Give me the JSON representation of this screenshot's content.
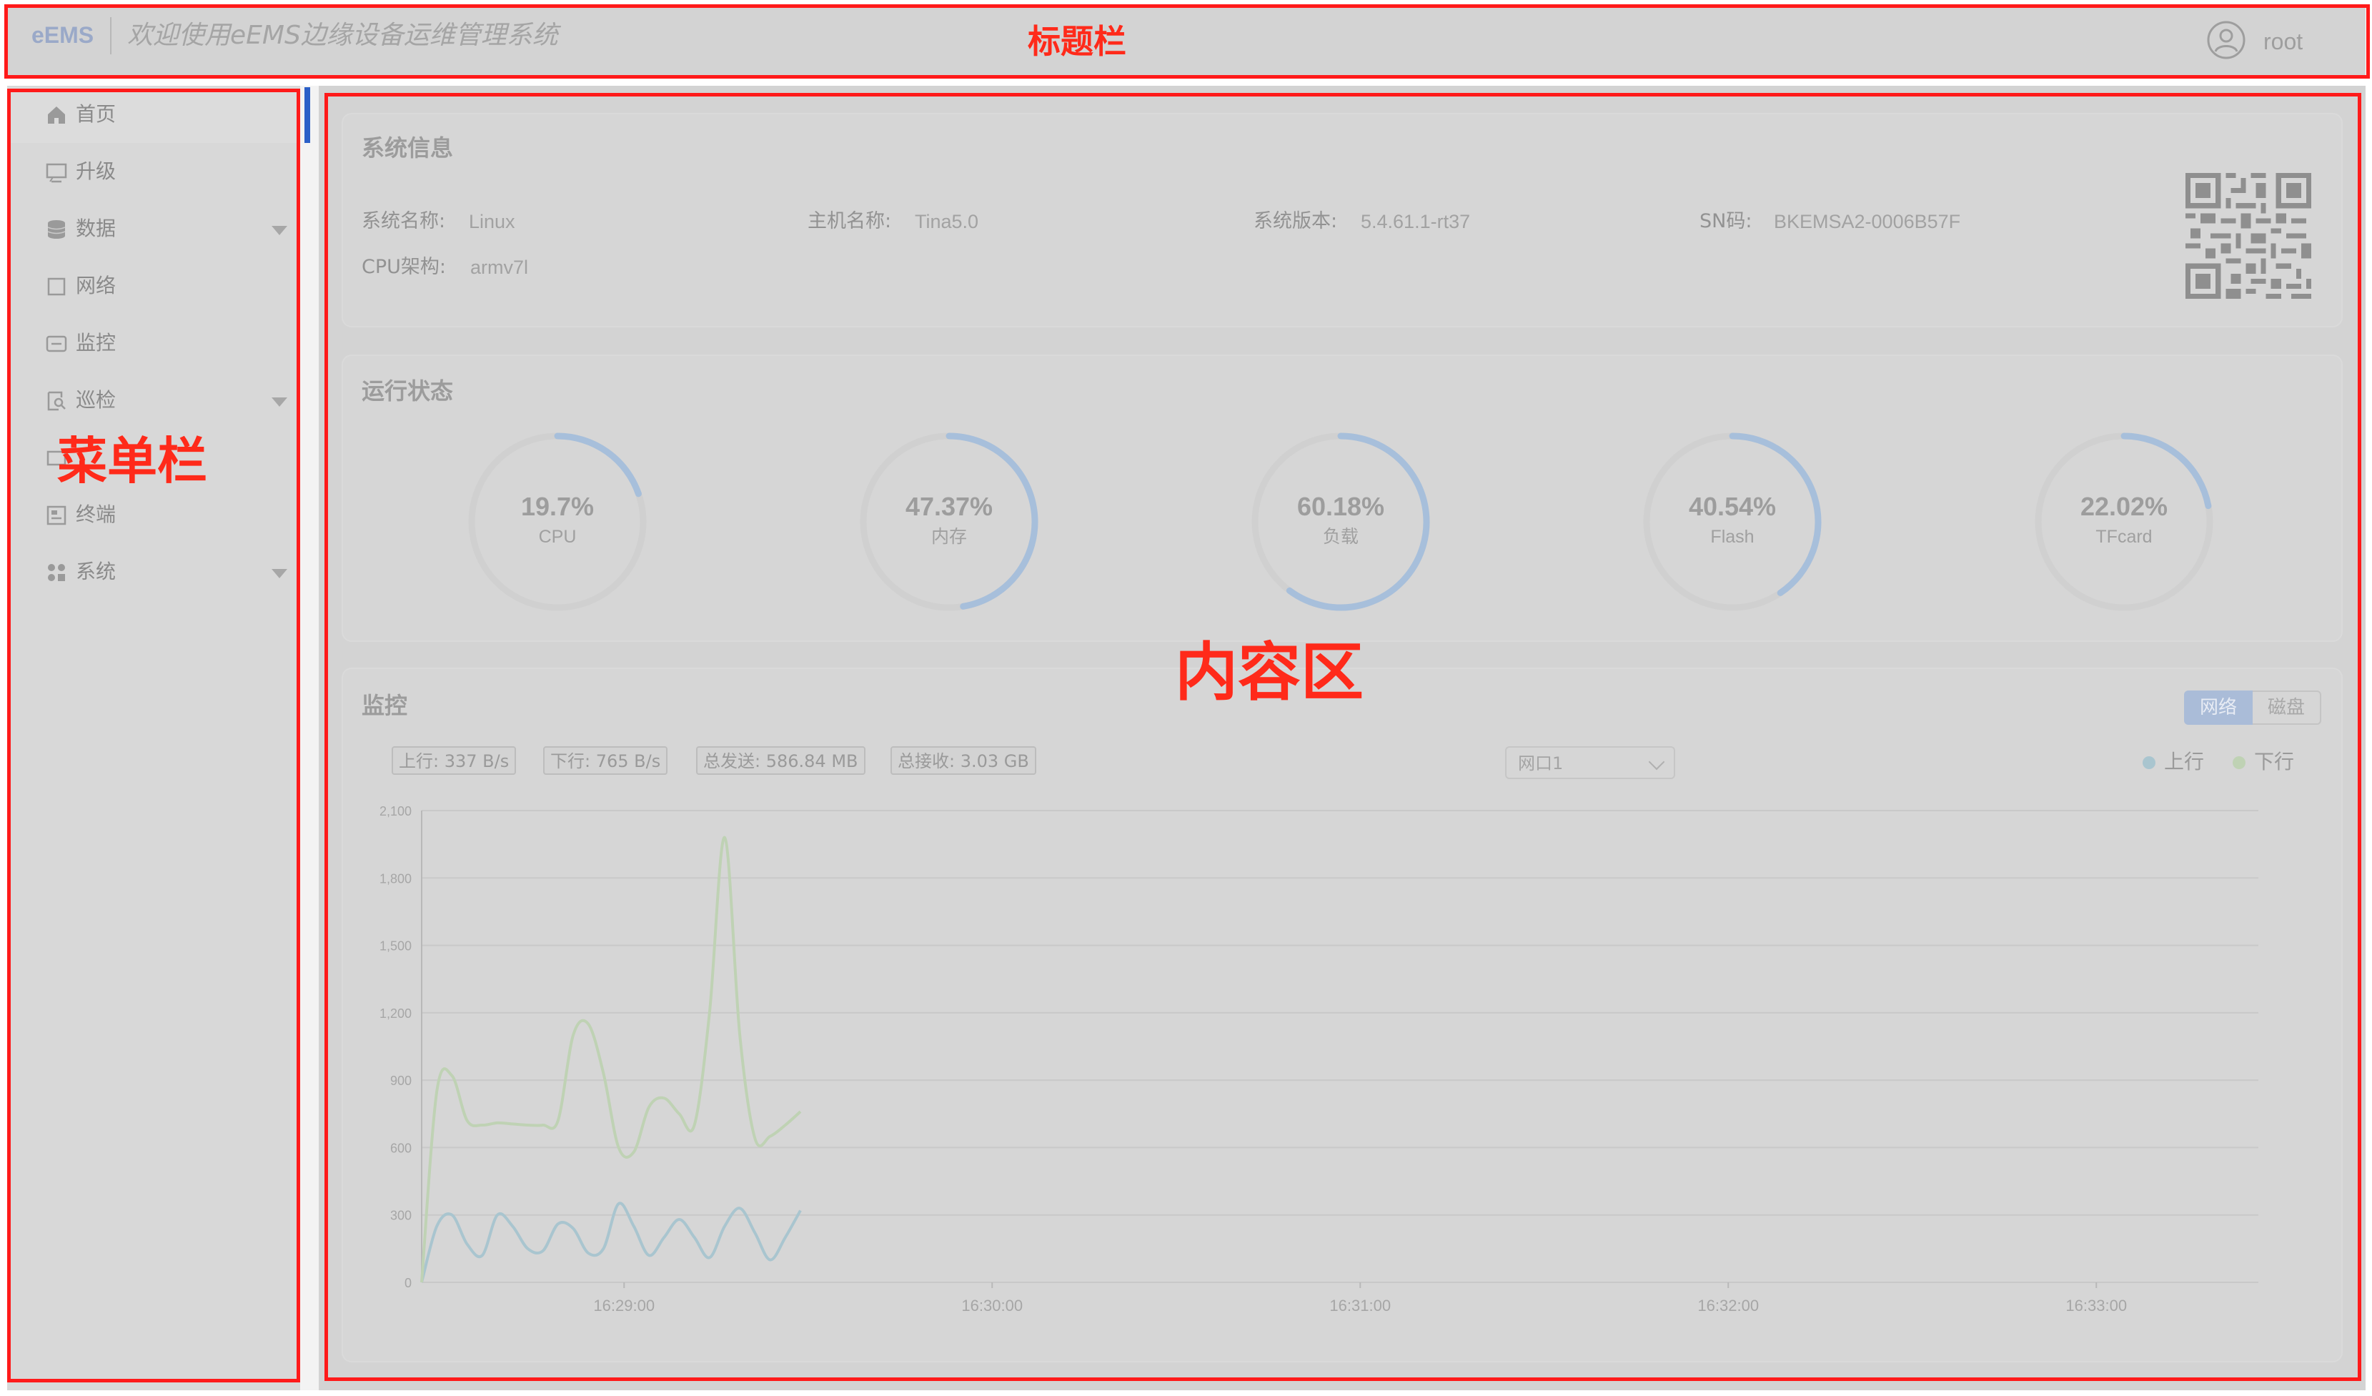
{
  "header": {
    "logo": "eEMS",
    "welcome": "欢迎使用eEMS边缘设备运维管理系统",
    "user": "root"
  },
  "sidebar": {
    "items": [
      {
        "label": "首页",
        "icon": "home-icon",
        "expandable": false,
        "active": true
      },
      {
        "label": "升级",
        "icon": "upgrade-icon",
        "expandable": false
      },
      {
        "label": "数据",
        "icon": "database-icon",
        "expandable": true
      },
      {
        "label": "网络",
        "icon": "network-icon",
        "expandable": false
      },
      {
        "label": "监控",
        "icon": "monitor-icon",
        "expandable": false
      },
      {
        "label": "巡检",
        "icon": "inspection-icon",
        "expandable": true
      },
      {
        "label": "",
        "icon": "hidden-item-icon",
        "expandable": false
      },
      {
        "label": "终端",
        "icon": "terminal-icon",
        "expandable": false
      },
      {
        "label": "系统",
        "icon": "system-grid-icon",
        "expandable": true
      }
    ]
  },
  "system_info": {
    "title": "系统信息",
    "fields": [
      {
        "label": "系统名称:",
        "value": "Linux"
      },
      {
        "label": "主机名称:",
        "value": "Tina5.0"
      },
      {
        "label": "系统版本:",
        "value": "5.4.61.1-rt37"
      },
      {
        "label": "SN码:",
        "value": "BKEMSA2-0006B57F"
      },
      {
        "label": "CPU架构:",
        "value": "armv7l"
      }
    ]
  },
  "run_status": {
    "title": "运行状态",
    "gauges": [
      {
        "percent_text": "19.7%",
        "value": 19.7,
        "name": "CPU"
      },
      {
        "percent_text": "47.37%",
        "value": 47.37,
        "name": "内存"
      },
      {
        "percent_text": "60.18%",
        "value": 60.18,
        "name": "负载"
      },
      {
        "percent_text": "40.54%",
        "value": 40.54,
        "name": "Flash"
      },
      {
        "percent_text": "22.02%",
        "value": 22.02,
        "name": "TFcard"
      }
    ]
  },
  "monitor": {
    "title": "监控",
    "tabs": {
      "network": "网络",
      "disk": "磁盘"
    },
    "stats": {
      "up": "上行: 337 B/s",
      "down": "下行: 765 B/s",
      "sent": "总发送: 586.84 MB",
      "recv": "总接收: 3.03 GB"
    },
    "port_select": "网口1",
    "legend": {
      "up": "上行",
      "down": "下行"
    }
  },
  "chart_data": {
    "type": "line",
    "y_ticks": [
      "0",
      "300",
      "600",
      "900",
      "1,200",
      "1,500",
      "1,800",
      "2,100"
    ],
    "ylim": [
      0,
      2100
    ],
    "x_ticks": [
      "16:29:00",
      "16:30:00",
      "16:31:00",
      "16:32:00",
      "16:33:00"
    ],
    "series": [
      {
        "name": "上行",
        "color": "#a9c5cf",
        "points": [
          [
            0,
            0
          ],
          [
            5,
            250
          ],
          [
            10,
            300
          ],
          [
            15,
            170
          ],
          [
            20,
            120
          ],
          [
            25,
            300
          ],
          [
            30,
            250
          ],
          [
            35,
            150
          ],
          [
            40,
            140
          ],
          [
            45,
            260
          ],
          [
            50,
            240
          ],
          [
            55,
            130
          ],
          [
            60,
            150
          ],
          [
            65,
            350
          ],
          [
            70,
            250
          ],
          [
            75,
            120
          ],
          [
            80,
            200
          ],
          [
            85,
            280
          ],
          [
            90,
            200
          ],
          [
            95,
            110
          ],
          [
            100,
            250
          ],
          [
            105,
            330
          ],
          [
            110,
            220
          ],
          [
            115,
            100
          ],
          [
            120,
            200
          ],
          [
            125,
            320
          ]
        ]
      },
      {
        "name": "下行",
        "color": "#bfd2b4",
        "points": [
          [
            0,
            0
          ],
          [
            5,
            850
          ],
          [
            10,
            920
          ],
          [
            15,
            720
          ],
          [
            20,
            700
          ],
          [
            25,
            710
          ],
          [
            30,
            705
          ],
          [
            35,
            700
          ],
          [
            40,
            700
          ],
          [
            45,
            720
          ],
          [
            50,
            1100
          ],
          [
            55,
            1150
          ],
          [
            60,
            930
          ],
          [
            65,
            600
          ],
          [
            70,
            580
          ],
          [
            75,
            780
          ],
          [
            80,
            820
          ],
          [
            85,
            750
          ],
          [
            90,
            700
          ],
          [
            95,
            1200
          ],
          [
            100,
            1980
          ],
          [
            105,
            1100
          ],
          [
            110,
            640
          ],
          [
            115,
            650
          ],
          [
            120,
            700
          ],
          [
            125,
            760
          ]
        ]
      }
    ]
  },
  "annotations": {
    "title_bar": "标题栏",
    "menu_bar": "菜单栏",
    "content_area": "内容区"
  },
  "colors": {
    "annotation_red": "#ff1a1a",
    "gauge_arc": "#a7bfdb",
    "accent": "#2b5fc7"
  }
}
